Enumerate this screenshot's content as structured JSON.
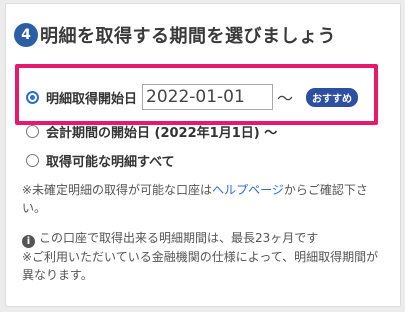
{
  "step": {
    "number": "4",
    "title": "明細を取得する期間を選びましょう"
  },
  "options": {
    "start_date": {
      "label": "明細取得開始日",
      "value": "2022-01-01",
      "tilde": "～",
      "badge": "おすすめ",
      "checked": true
    },
    "fiscal_start": {
      "label": "会計期間の開始日 (2022年1月1日) ～",
      "checked": false
    },
    "all": {
      "label": "取得可能な明細すべて",
      "checked": false
    }
  },
  "notes": {
    "unconfirmed_prefix": "※未確定明細の取得が可能な口座は",
    "help_link": "ヘルプページ",
    "unconfirmed_suffix": "からご確認下さい。",
    "max_period": "この口座で取得出来る明細期間は、最長23ヶ月です",
    "institution_note": "※ご利用いただいている金融機関の仕様によって、明細取得期間が異なります。"
  },
  "colors": {
    "accent": "#2c5ea8",
    "highlight": "#e6196c",
    "link": "#2c6fd1"
  }
}
